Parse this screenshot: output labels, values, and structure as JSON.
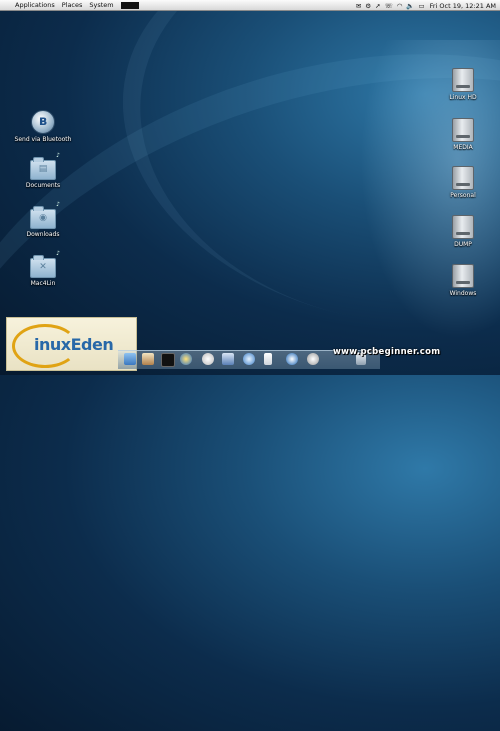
{
  "menubar": {
    "applications": "Applications",
    "places": "Places",
    "system": "System",
    "clock": "Fri Oct 19, 12:21 AM",
    "status_icons": [
      "mail-icon",
      "settings-icon",
      "cursor-icon",
      "chat-icon",
      "wifi-icon",
      "volume-icon",
      "battery-icon"
    ]
  },
  "desktop_left": [
    {
      "label": "Send via Bluetooth",
      "icon": "bluetooth-icon"
    },
    {
      "label": "Documents",
      "icon": "documents-folder-icon"
    },
    {
      "label": "Downloads",
      "icon": "downloads-folder-icon"
    },
    {
      "label": "Mac4Lin",
      "icon": "mac4lin-folder-icon"
    }
  ],
  "desktop_right": [
    {
      "label": "Linux HD",
      "icon": "hard-drive-icon"
    },
    {
      "label": "MEDIA",
      "icon": "hard-drive-icon"
    },
    {
      "label": "Personal",
      "icon": "hard-drive-icon"
    },
    {
      "label": "DUMP",
      "icon": "hard-drive-icon"
    },
    {
      "label": "Windows",
      "icon": "hard-drive-icon"
    }
  ],
  "logo": {
    "text": "inuxEden"
  },
  "watermark": "www.pcbeginner.com",
  "dock_items": [
    "finder-icon",
    "home-icon",
    "terminal-icon",
    "browser-icon",
    "clock-icon",
    "photo-icon",
    "music-icon",
    "ipod-icon",
    "thunderbird-icon",
    "chat-icon",
    "trash-icon"
  ]
}
